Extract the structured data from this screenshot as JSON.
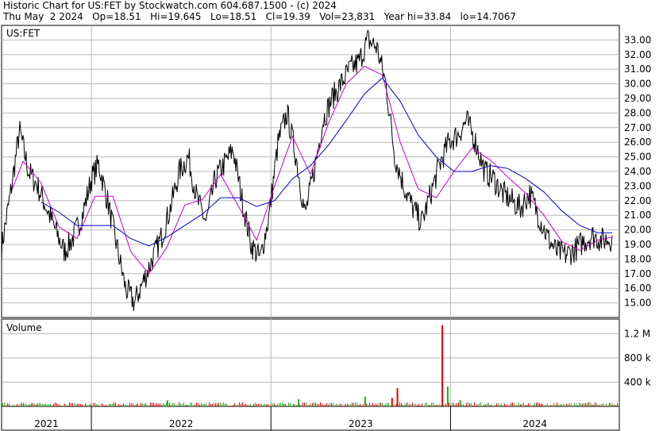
{
  "header": {
    "line1": "Historic Chart for US:FET by Stockwatch.com 604.687.1500 - (c) 2024",
    "line2": "Thu May  2 2024   Op=18.51   Hi=19.645   Lo=18.51   Cl=19.39   Vol=23,831   Year hi=33.84   lo=14.7067"
  },
  "colors": {
    "price": "#000000",
    "ma_short": "#cc00cc",
    "ma_long": "#0000cc",
    "volume_up": "#22aa22",
    "volume_down": "#dd0000",
    "grid": "#b8b8b8"
  },
  "chart_data": [
    {
      "type": "line",
      "title": "US:FET",
      "y_ticks": [
        "33.00",
        "32.00",
        "31.00",
        "30.00",
        "29.00",
        "28.00",
        "27.00",
        "26.00",
        "25.00",
        "24.00",
        "23.00",
        "22.00",
        "21.00",
        "20.00",
        "19.00",
        "18.00",
        "17.00",
        "16.00",
        "15.00"
      ],
      "ylim": [
        14.0,
        34.0
      ],
      "xlim": [
        2020.93,
        2024.37
      ],
      "grid": true,
      "series": [
        {
          "key": "price",
          "x": [
            2020.93,
            2020.98,
            2021.03,
            2021.08,
            2021.13,
            2021.18,
            2021.23,
            2021.28,
            2021.33,
            2021.38,
            2021.43,
            2021.47,
            2021.52,
            2021.57,
            2021.62,
            2021.67,
            2021.72,
            2021.77,
            2021.82,
            2021.87,
            2021.92,
            2021.97,
            2022.02,
            2022.07,
            2022.12,
            2022.17,
            2022.22,
            2022.27,
            2022.32,
            2022.37,
            2022.42,
            2022.47,
            2022.52,
            2022.57,
            2022.62,
            2022.67,
            2022.72,
            2022.77,
            2022.82,
            2022.87,
            2022.92,
            2022.97,
            2023.02,
            2023.07,
            2023.12,
            2023.17,
            2023.22,
            2023.27,
            2023.32,
            2023.37,
            2023.42,
            2023.47,
            2023.52,
            2023.57,
            2023.62,
            2023.67,
            2023.72,
            2023.77,
            2023.82,
            2023.87,
            2023.92,
            2023.97,
            2024.02,
            2024.07,
            2024.12,
            2024.17,
            2024.22,
            2024.27,
            2024.33
          ],
          "y": [
            18.8,
            22.5,
            26.8,
            24.0,
            23.0,
            21.5,
            20.0,
            18.5,
            19.5,
            21.0,
            23.5,
            24.5,
            22.0,
            19.0,
            16.0,
            15.0,
            16.5,
            18.0,
            19.5,
            21.5,
            24.0,
            25.0,
            22.0,
            20.5,
            23.5,
            24.5,
            25.5,
            22.0,
            19.0,
            18.0,
            21.0,
            26.0,
            28.0,
            25.0,
            21.0,
            24.0,
            27.5,
            29.0,
            30.0,
            31.0,
            31.5,
            33.0,
            32.5,
            30.0,
            25.0,
            23.0,
            21.5,
            20.5,
            22.5,
            24.5,
            26.0,
            26.5,
            27.5,
            26.0,
            24.0,
            23.5,
            22.5,
            22.0,
            21.5,
            22.5,
            21.0,
            19.5,
            18.5,
            18.3,
            18.6,
            19.2,
            19.6,
            19.3,
            19.4
          ]
        },
        {
          "key": "ma_short",
          "x": [
            2020.99,
            2021.05,
            2021.15,
            2021.25,
            2021.35,
            2021.45,
            2021.55,
            2021.65,
            2021.75,
            2021.85,
            2021.95,
            2022.05,
            2022.15,
            2022.25,
            2022.35,
            2022.45,
            2022.55,
            2022.65,
            2022.75,
            2022.85,
            2022.95,
            2023.05,
            2023.15,
            2023.25,
            2023.35,
            2023.45,
            2023.55,
            2023.65,
            2023.75,
            2023.85,
            2023.95,
            2024.05,
            2024.15,
            2024.25,
            2024.33
          ],
          "y": [
            22.8,
            24.7,
            23.2,
            20.2,
            19.4,
            22.3,
            22.3,
            18.5,
            17.0,
            18.8,
            21.7,
            22.1,
            23.8,
            21.6,
            19.3,
            23.0,
            26.4,
            23.8,
            27.3,
            30.0,
            31.2,
            30.6,
            26.0,
            22.8,
            22.2,
            24.0,
            25.6,
            24.8,
            23.6,
            22.5,
            21.0,
            19.2,
            18.6,
            19.3,
            19.5
          ]
        },
        {
          "key": "ma_long",
          "x": [
            2021.15,
            2021.25,
            2021.35,
            2021.45,
            2021.55,
            2021.65,
            2021.75,
            2021.85,
            2021.95,
            2022.05,
            2022.15,
            2022.25,
            2022.35,
            2022.45,
            2022.55,
            2022.65,
            2022.75,
            2022.85,
            2022.95,
            2023.05,
            2023.15,
            2023.25,
            2023.35,
            2023.45,
            2023.55,
            2023.65,
            2023.75,
            2023.85,
            2023.95,
            2024.05,
            2024.15,
            2024.25,
            2024.33
          ],
          "y": [
            21.9,
            21.2,
            20.3,
            20.3,
            20.3,
            19.4,
            18.9,
            19.5,
            20.3,
            21.1,
            22.2,
            22.2,
            21.6,
            22.0,
            23.5,
            24.4,
            25.8,
            27.5,
            29.3,
            30.4,
            28.8,
            26.5,
            25.0,
            24.0,
            24.0,
            24.4,
            24.2,
            23.5,
            22.6,
            21.3,
            20.3,
            19.8,
            19.8
          ]
        }
      ]
    },
    {
      "type": "bar",
      "title": "Volume",
      "y_ticks": [
        "1.2 M",
        "800 k",
        "400 k"
      ],
      "ylim": [
        0,
        1440000
      ],
      "xlim": [
        2020.93,
        2024.37
      ],
      "spikes": [
        {
          "x": 2022.95,
          "value": 160000,
          "color": "up"
        },
        {
          "x": 2023.1,
          "value": 140000,
          "color": "down"
        },
        {
          "x": 2023.13,
          "value": 300000,
          "color": "down"
        },
        {
          "x": 2023.38,
          "value": 1340000,
          "color": "down"
        },
        {
          "x": 2023.41,
          "value": 330000,
          "color": "up"
        },
        {
          "x": 2022.58,
          "value": 120000,
          "color": "up"
        },
        {
          "x": 2021.85,
          "value": 100000,
          "color": "up"
        },
        {
          "x": 2023.48,
          "value": 100000,
          "color": "up"
        }
      ],
      "typical_volume": 40000
    }
  ],
  "x_axis": {
    "labels": [
      "2021",
      "2022",
      "2023",
      "2024"
    ],
    "dividers": [
      2021.43,
      2022.43,
      2023.43
    ]
  }
}
